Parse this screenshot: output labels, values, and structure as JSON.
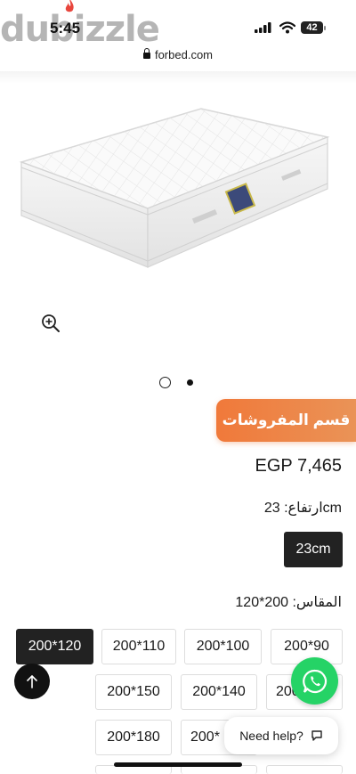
{
  "watermark": "dubizzle",
  "status": {
    "time": "5:45",
    "battery": "42"
  },
  "browser": {
    "url": "forbed.com"
  },
  "category_badge": "قسم المفروشات",
  "price": "EGP 7,465",
  "height_option": {
    "label": "ارتفاع: 23cm",
    "choices": [
      "23cm"
    ],
    "selected": "23cm"
  },
  "size_option": {
    "label": "المقاس: 200*120",
    "row1": [
      "200*120",
      "200*110",
      "200*100",
      "200*90"
    ],
    "row2": [
      "200*150",
      "200*140",
      "200*"
    ],
    "row3": [
      "200*180",
      "200*"
    ],
    "selected": "200*120"
  },
  "help_button": "Need help?",
  "colors": {
    "accent": "#f0793a",
    "whatsapp": "#25d366",
    "selected_chip": "#222222"
  }
}
